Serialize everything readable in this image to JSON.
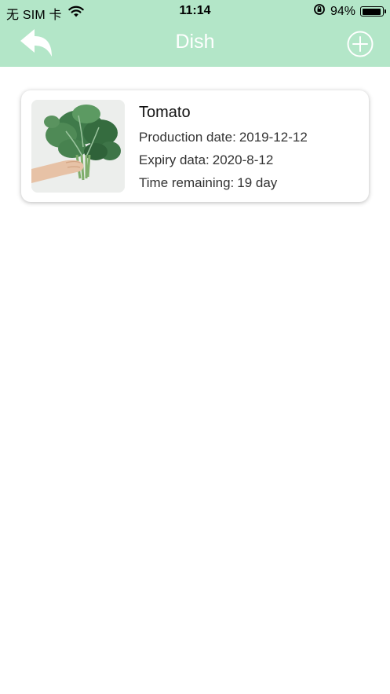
{
  "status_bar": {
    "carrier": "无 SIM 卡",
    "time": "11:14",
    "battery_percent": "94%",
    "battery_level": 0.94
  },
  "nav": {
    "title": "Dish",
    "back_icon": "back-arrow-icon",
    "add_icon": "add-circle-icon"
  },
  "dishes": [
    {
      "name": "Tomato",
      "production_label": "Production date:",
      "production_value": "2019-12-12",
      "expiry_label": "Expiry data:",
      "expiry_value": "2020-8-12",
      "remaining_label": "Time remaining:",
      "remaining_value": "19 day"
    }
  ],
  "colors": {
    "header": "#b3e6c8",
    "nav_icon": "#ffffff"
  }
}
